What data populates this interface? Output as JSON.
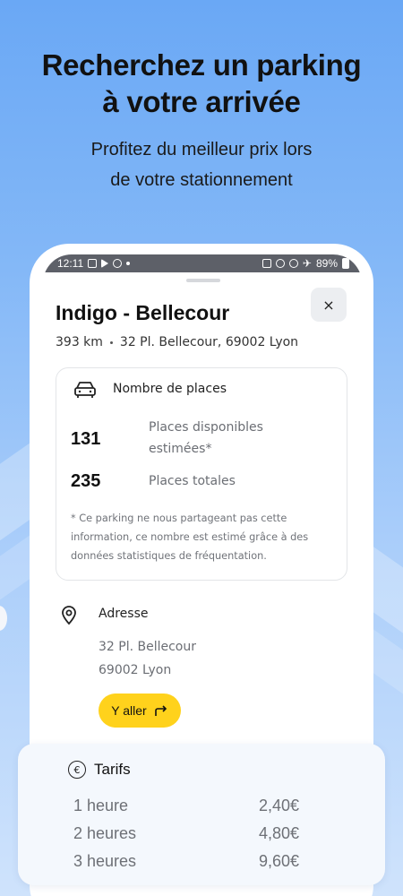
{
  "promo": {
    "headline_1": "Recherchez un parking",
    "headline_2": "à votre arrivée",
    "subline_1": "Profitez du meilleur prix lors",
    "subline_2": "de votre stationnement"
  },
  "statusbar": {
    "time": "12:11",
    "battery": "89%"
  },
  "parking": {
    "name": "Indigo - Bellecour",
    "distance": "393 km",
    "address_short": "32 Pl. Bellecour, 69002 Lyon",
    "close_label": "×"
  },
  "places": {
    "title": "Nombre de places",
    "available_value": "131",
    "available_label_1": "Places disponibles",
    "available_label_2": "estimées*",
    "total_value": "235",
    "total_label": "Places totales",
    "footnote_1": "* Ce parking ne nous partageant pas cette",
    "footnote_2": "information, ce nombre est estimé grâce à des",
    "footnote_3": "données statistiques de fréquentation."
  },
  "address": {
    "title": "Adresse",
    "line_1": "32 Pl. Bellecour",
    "line_2": "69002 Lyon",
    "go_label": "Y aller"
  },
  "tarifs": {
    "title": "Tarifs",
    "currency_symbol": "€",
    "rows": [
      {
        "duration": "1 heure",
        "price": "2,40€"
      },
      {
        "duration": "2 heures",
        "price": "4,80€"
      },
      {
        "duration": "3 heures",
        "price": "9,60€"
      }
    ]
  }
}
